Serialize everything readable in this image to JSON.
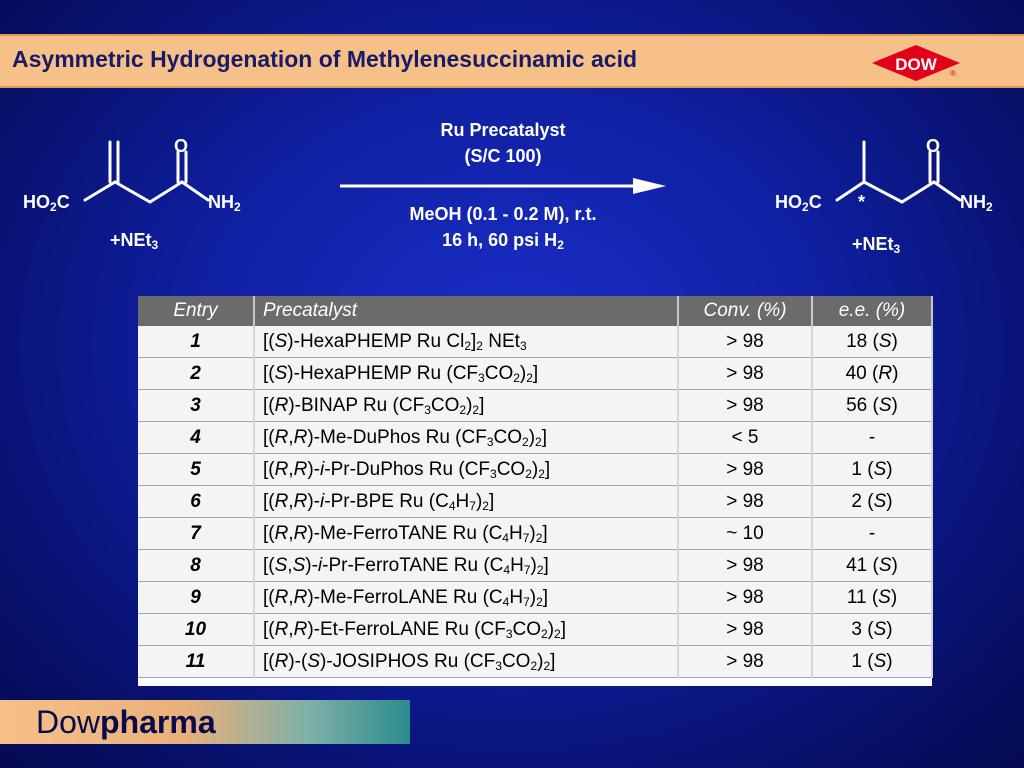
{
  "title": "Asymmetric Hydrogenation of Methylenesuccinamic acid",
  "logo_text": "DOW",
  "logo_mark": "®",
  "scheme": {
    "reactant": {
      "left_group": "HO2C",
      "right_group": "NH2",
      "carbonyl": "O",
      "salt": "+NEt3"
    },
    "product": {
      "left_group": "HO2C",
      "right_group": "NH2",
      "carbonyl": "O",
      "stereocenter": "*",
      "salt": "+NEt3"
    },
    "cond_line1": "Ru Precatalyst",
    "cond_line2": "(S/C 100)",
    "cond_line3": "MeOH (0.1 - 0.2 M), r.t.",
    "cond_line4": "16 h, 60 psi H2"
  },
  "table": {
    "headers": [
      "Entry",
      "Precatalyst",
      "Conv. (%)",
      "e.e. (%)"
    ],
    "rows": [
      {
        "entry": "1",
        "precatalyst": "[(S)-HexaPHEMP Ru Cl2]2 NEt3",
        "conv": "> 98",
        "ee": "18 (S)"
      },
      {
        "entry": "2",
        "precatalyst": "[(S)-HexaPHEMP Ru (CF3CO2)2]",
        "conv": "> 98",
        "ee": "40 (R)"
      },
      {
        "entry": "3",
        "precatalyst": "[(R)-BINAP Ru (CF3CO2)2]",
        "conv": "> 98",
        "ee": "56 (S)"
      },
      {
        "entry": "4",
        "precatalyst": "[(R,R)-Me-DuPhos Ru (CF3CO2)2]",
        "conv": "< 5",
        "ee": "-"
      },
      {
        "entry": "5",
        "precatalyst": "[(R,R)-i-Pr-DuPhos Ru (CF3CO2)2]",
        "conv": "> 98",
        "ee": "1 (S)"
      },
      {
        "entry": "6",
        "precatalyst": "[(R,R)-i-Pr-BPE Ru (C4H7)2]",
        "conv": "> 98",
        "ee": "2 (S)"
      },
      {
        "entry": "7",
        "precatalyst": "[(R,R)-Me-FerroTANE Ru (C4H7)2]",
        "conv": "~ 10",
        "ee": "-"
      },
      {
        "entry": "8",
        "precatalyst": "[(S,S)-i-Pr-FerroTANE Ru (C4H7)2]",
        "conv": "> 98",
        "ee": "41 (S)"
      },
      {
        "entry": "9",
        "precatalyst": "[(R,R)-Me-FerroLANE Ru (C4H7)2]",
        "conv": "> 98",
        "ee": "11 (S)"
      },
      {
        "entry": "10",
        "precatalyst": "[(R,R)-Et-FerroLANE Ru (CF3CO2)2]",
        "conv": "> 98",
        "ee": "3 (S)"
      },
      {
        "entry": "11",
        "precatalyst": "[(R)-(S)-JOSIPHOS Ru (CF3CO2)2]",
        "conv": "> 98",
        "ee": "1 (S)"
      }
    ]
  },
  "footer": {
    "part1": "Dow",
    "part2": "pharma"
  },
  "colors": {
    "title_bar": "#f6c089",
    "title_text": "#1a1a66",
    "header_bg": "#6b6b6b",
    "logo_red": "#e3001b"
  }
}
